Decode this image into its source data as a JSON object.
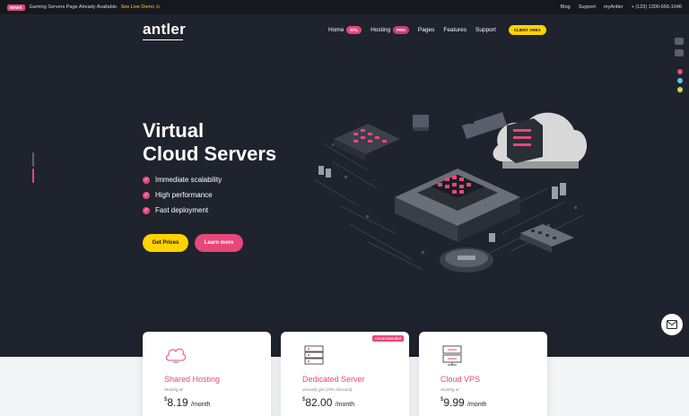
{
  "topbar": {
    "badge": "NEWS",
    "message": "Gaming Servers Page Already Available.",
    "demo_link": "See Live Demo",
    "links": [
      "Blog",
      "Support",
      "myAntler"
    ],
    "phone": "+ (123) 1300-656-1046"
  },
  "nav": {
    "logo": "antler",
    "items": [
      {
        "label": "Home",
        "badge": "RTL"
      },
      {
        "label": "Hosting",
        "badge": "PRO"
      },
      {
        "label": "Pages"
      },
      {
        "label": "Features"
      },
      {
        "label": "Support"
      }
    ],
    "client_area": "CLIENT AREA"
  },
  "hero": {
    "title_line1": "Virtual",
    "title_line2": "Cloud Servers",
    "features": [
      "Immediate scalability",
      "High performance",
      "Fast deployment"
    ],
    "primary_button": "Get Prices",
    "secondary_button": "Learn more"
  },
  "plans": [
    {
      "name": "Shared Hosting",
      "subtitle": "Starting at:",
      "currency": "$",
      "price": "8.19",
      "period": "/month",
      "icon": "cloud-icon"
    },
    {
      "name": "Dedicated Server",
      "subtitle": "annually get (20% discount)",
      "currency": "$",
      "price": "82.00",
      "period": "/month",
      "badge": "recommended",
      "icon": "server-icon"
    },
    {
      "name": "Cloud VPS",
      "subtitle": "Starting at:",
      "currency": "$",
      "price": "9.99",
      "period": "/month",
      "icon": "vps-icon"
    }
  ],
  "colors": {
    "background": "#1e232d",
    "accent_pink": "#e8477a",
    "accent_yellow": "#ffd200",
    "switcher_dots": [
      "#e8477a",
      "#5bc8f0",
      "#c5e04a"
    ]
  }
}
